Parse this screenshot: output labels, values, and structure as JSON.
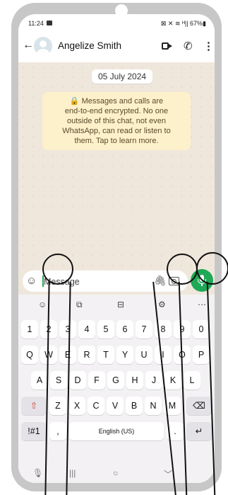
{
  "status": {
    "time": "11:24",
    "right": "⊠ ✕ ≋ ᴴ|| 67%▮"
  },
  "header": {
    "back": "←",
    "contact": "Angelize Smith",
    "call": "✆",
    "menu": "⋮"
  },
  "chat": {
    "date": "05 July 2024",
    "notice_lines": [
      "🔒 Messages and calls are",
      "end-to-end encrypted. No one",
      "outside of this chat, not even",
      "WhatsApp, can read or listen to",
      "them. Tap to learn more."
    ]
  },
  "compose": {
    "emoji": "☺",
    "placeholder": "Message",
    "attach": "🖇"
  },
  "keyboard": {
    "toolbar": [
      "☺",
      "⧉",
      "⊟",
      "⚙",
      "⋯"
    ],
    "row1": [
      "1",
      "2",
      "3",
      "4",
      "5",
      "6",
      "7",
      "8",
      "9",
      "0"
    ],
    "row2": [
      "Q",
      "W",
      "E",
      "R",
      "T",
      "Y",
      "U",
      "I",
      "O",
      "P"
    ],
    "row3": [
      "A",
      "S",
      "D",
      "F",
      "G",
      "H",
      "J",
      "K",
      "L"
    ],
    "row4": [
      "⇧",
      "Z",
      "X",
      "C",
      "V",
      "B",
      "N",
      "M",
      "⌫"
    ],
    "row5": {
      "sym": "!#1",
      "comma": ",",
      "space": "English (US)",
      "period": ".",
      "enter": "↵"
    }
  },
  "navbar": {
    "mic": "🎙",
    "recent": "|||",
    "home": "○",
    "back": "﹀"
  },
  "colors": {
    "accent": "#1fa855",
    "chat_bg": "#efe7dc",
    "notice_bg": "#fdf1cb"
  }
}
